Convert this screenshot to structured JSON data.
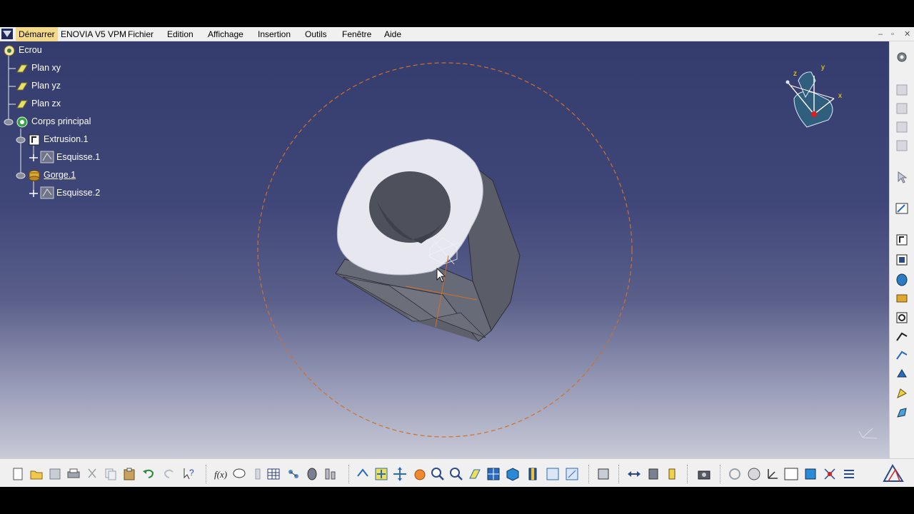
{
  "menubar": {
    "items": [
      "Démarrer",
      "ENOVIA V5 VPM",
      "Fichier",
      "Edition",
      "Affichage",
      "Insertion",
      "Outils",
      "Fenêtre",
      "Aide"
    ],
    "window_controls": [
      "–",
      "▫",
      "✕"
    ]
  },
  "tree": {
    "root": "Ecrou",
    "plane_xy": "Plan xy",
    "plane_yz": "Plan yz",
    "plane_zx": "Plan zx",
    "body": "Corps principal",
    "extrusion": "Extrusion.1",
    "sketch1": "Esquisse.1",
    "groove": "Gorge.1",
    "sketch2": "Esquisse.2"
  },
  "compass": {
    "x": "x",
    "y": "y",
    "z": "z"
  },
  "colors": {
    "menubar_bg": "#f0f0f0",
    "menu_active": "#f5d98a",
    "viewport_top": "#343c6e",
    "viewport_bottom": "#c9cad8",
    "rotation_circle": "#d0702a",
    "nut_top_face": "#e4e4ee",
    "nut_side_face": "#62646f",
    "tree_plane_icon": "#e8e06a"
  },
  "icons": {
    "bottom_toolbar": [
      "new-icon",
      "open-icon",
      "save-icon",
      "print-icon",
      "cut-icon",
      "copy-icon",
      "paste-icon",
      "undo-icon",
      "redo-icon",
      "whats-this-icon",
      "formula-icon",
      "comment-icon",
      "knowledge-icon",
      "table-icon",
      "parameters-icon",
      "catalog-icon",
      "analysis-icon",
      "fly-mode-icon",
      "fit-all-icon",
      "pan-icon",
      "rotate-icon",
      "zoom-in-icon",
      "zoom-out-icon",
      "normal-view-icon",
      "multi-view-icon",
      "iso-view-icon",
      "shading-icon",
      "hide-show-icon",
      "swap-visible-icon",
      "apply-material-icon",
      "measure-between-icon",
      "measure-item-icon",
      "measure-inertia-icon",
      "capture-icon",
      "update-icon",
      "stop-icon",
      "grid-icon",
      "axis-system-icon",
      "decimal-icon",
      "snap-icon",
      "compass-icon",
      "catia-logo-icon"
    ],
    "right_toolbar": [
      "settings-icon",
      "view-a-icon",
      "view-b-icon",
      "view-c-icon",
      "view-d-icon",
      "select-icon",
      "sketch-icon",
      "pad-icon",
      "pocket-icon",
      "shaft-icon",
      "groove-icon",
      "hole-icon",
      "rib-icon",
      "slot-icon",
      "stiffener-icon",
      "multi-section-icon",
      "solid-combine-icon"
    ]
  }
}
